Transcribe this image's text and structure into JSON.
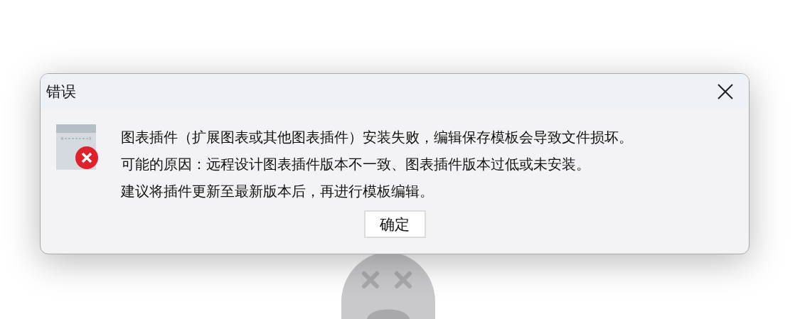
{
  "window": {
    "title": "错误"
  },
  "message": {
    "lines": [
      "图表插件（扩展图表或其他图表插件）安装失败，编辑保存模板会导致文件损坏。",
      "可能的原因：远程设计图表插件版本不一致、图表插件版本过低或未安装。",
      "建议将插件更新至最新版本后，再进行模板编辑。"
    ]
  },
  "buttons": [
    {
      "label": "确定"
    }
  ]
}
